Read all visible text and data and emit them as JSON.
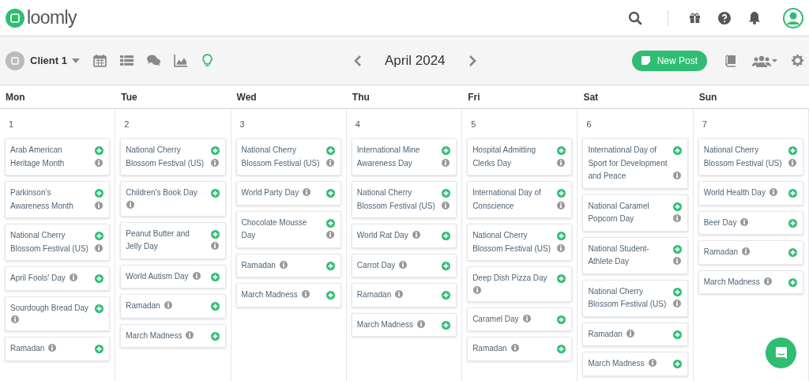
{
  "app": {
    "brand": "loomly"
  },
  "toolbar": {
    "client": "Client 1",
    "month": "April 2024",
    "new_post": "New Post",
    "views": [
      {
        "kind": "calendar",
        "selected": false
      },
      {
        "kind": "list",
        "selected": false
      },
      {
        "kind": "chat",
        "selected": false
      },
      {
        "kind": "chart",
        "selected": false
      },
      {
        "kind": "bulb",
        "selected": true
      }
    ]
  },
  "calendar": {
    "weekdays": [
      "Mon",
      "Tue",
      "Wed",
      "Thu",
      "Fri",
      "Sat",
      "Sun"
    ],
    "days": [
      {
        "date": "1",
        "events": [
          "Arab American Heritage Month",
          "Parkinson’s Awareness Month",
          "National Cherry Blossom Festival (US)",
          "April Fools' Day",
          "Sourdough Bread Day",
          "Ramadan"
        ]
      },
      {
        "date": "2",
        "events": [
          "National Cherry Blossom Festival (US)",
          "Children’s Book Day",
          "Peanut Butter and Jelly Day",
          "World Autism Day",
          "Ramadan",
          "March Madness"
        ]
      },
      {
        "date": "3",
        "events": [
          "National Cherry Blossom Festival (US)",
          "World Party Day",
          "Chocolate Mousse Day",
          "Ramadan",
          "March Madness"
        ]
      },
      {
        "date": "4",
        "events": [
          "International Mine Awareness Day",
          "National Cherry Blossom Festival (US)",
          "World Rat Day",
          "Carrot Day",
          "Ramadan",
          "March Madness"
        ]
      },
      {
        "date": "5",
        "events": [
          "Hospital Admitting Clerks Day",
          "International Day of Conscience",
          "National Cherry Blossom Festival (US)",
          "Deep Dish Pizza Day",
          "Caramel Day",
          "Ramadan"
        ]
      },
      {
        "date": "6",
        "events": [
          "International Day of Sport for Development and Peace",
          "National Caramel Popcorn Day",
          "National Student-Athlete Day",
          "National Cherry Blossom Festival (US)",
          "Ramadan",
          "March Madness"
        ]
      },
      {
        "date": "7",
        "events": [
          "National Cherry Blossom Festival (US)",
          "World Health Day",
          "Beer Day",
          "Ramadan",
          "March Madness"
        ]
      }
    ]
  }
}
